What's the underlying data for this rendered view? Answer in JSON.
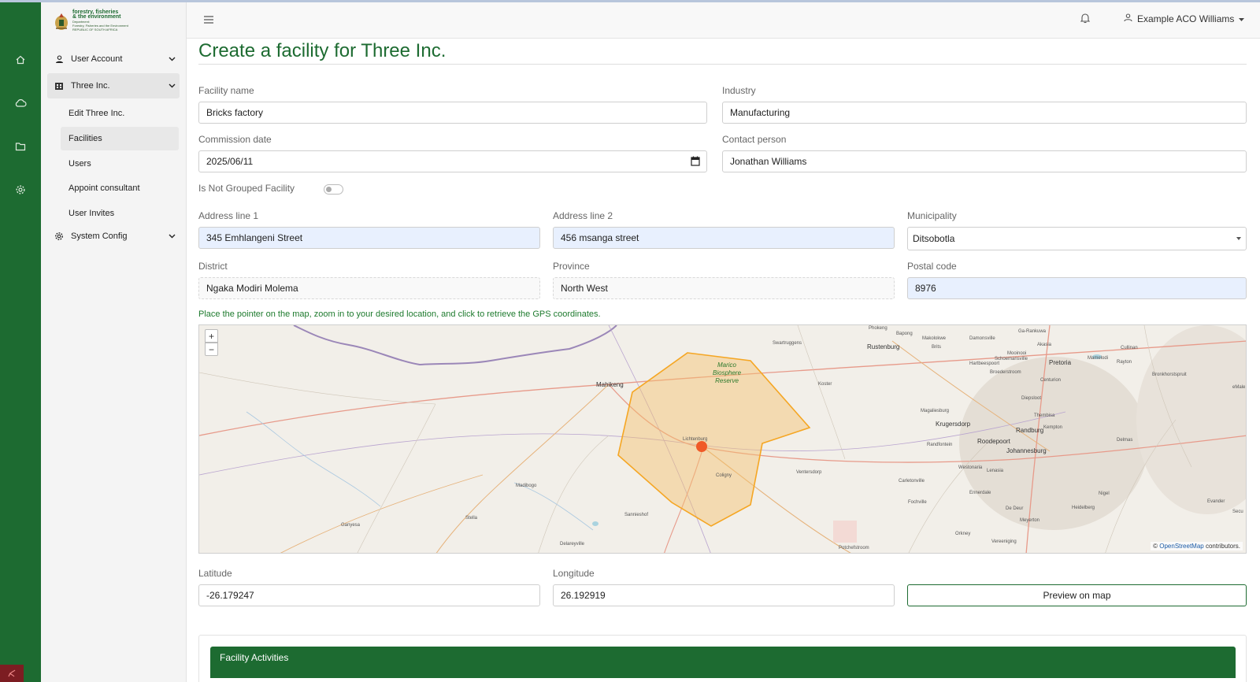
{
  "colors": {
    "brand_green": "#1d6b31",
    "autofill_bg": "#e8f0fe",
    "map_polygon": "#f5a623",
    "marker": "#f05a28"
  },
  "logo": {
    "line1": "forestry, fisheries",
    "line2": "& the environment",
    "line3": "Department:",
    "line4": "Forestry, Fisheries and the Environment",
    "line5": "REPUBLIC OF SOUTH AFRICA"
  },
  "rail": {
    "icons": [
      "home-icon",
      "cloud-icon",
      "folder-icon",
      "gear-icon"
    ]
  },
  "sidebar": {
    "groups": [
      {
        "label": "User Account",
        "icon": "user-icon"
      },
      {
        "label": "Three Inc.",
        "icon": "building-icon"
      },
      {
        "label": "System Config",
        "icon": "gear-icon"
      }
    ],
    "sub_items": [
      {
        "label": "Edit Three Inc."
      },
      {
        "label": "Facilities"
      },
      {
        "label": "Users"
      },
      {
        "label": "Appoint consultant"
      },
      {
        "label": "User Invites"
      }
    ]
  },
  "header": {
    "user_name": "Example ACO Williams"
  },
  "page": {
    "title": "Create a facility for Three Inc."
  },
  "form": {
    "facility_name": {
      "label": "Facility name",
      "value": "Bricks factory"
    },
    "industry": {
      "label": "Industry",
      "value": "Manufacturing"
    },
    "commission_date": {
      "label": "Commission date",
      "value": "2025/06/11"
    },
    "contact_person": {
      "label": "Contact person",
      "value": "Jonathan Williams"
    },
    "not_grouped": {
      "label": "Is Not Grouped Facility",
      "checked": false
    },
    "address1": {
      "label": "Address line 1",
      "value": "345 Emhlangeni Street"
    },
    "address2": {
      "label": "Address line 2",
      "value": "456 msanga street"
    },
    "municipality": {
      "label": "Municipality",
      "value": "Ditsobotla"
    },
    "district": {
      "label": "District",
      "value": "Ngaka Modiri Molema"
    },
    "province": {
      "label": "Province",
      "value": "North West"
    },
    "postal_code": {
      "label": "Postal code",
      "value": "8976"
    },
    "latitude": {
      "label": "Latitude",
      "value": "-26.179247"
    },
    "longitude": {
      "label": "Longitude",
      "value": "26.192919"
    }
  },
  "map": {
    "hint": "Place the pointer on the map, zoom in to your desired location, and click to retrieve the GPS coordinates.",
    "zoom_in": "+",
    "zoom_out": "−",
    "attribution_prefix": "©",
    "attribution_link": "OpenStreetMap",
    "attribution_suffix": "contributors.",
    "reserve_label": [
      "Marico",
      "Biosphere",
      "Reserve"
    ],
    "places": [
      "Mahikeng",
      "Lichtenburg",
      "Coligny",
      "Sannieshof",
      "Delareyville",
      "Stella",
      "Ganyesa",
      "Madibogo",
      "Swartruggens",
      "Koster",
      "Rustenburg",
      "Pretoria",
      "Magaliesburg",
      "Krugersdorp",
      "Randburg",
      "Roodepoort",
      "Johannesburg",
      "Randfontein",
      "Carletonville",
      "Ventersdorp",
      "Potchefstroom",
      "Vereeniging",
      "Meyerton",
      "De Deur",
      "Heidelberg",
      "Nigel",
      "Evander",
      "Delmas",
      "Kempton",
      "Thembisa",
      "Centurion",
      "Brits",
      "Hartbeespoort",
      "Mamelodi",
      "Cullinan",
      "Rayton",
      "Bronkhorstspruit",
      "Schoemansville",
      "Broederstroom",
      "Mooinooi",
      "Makolokwe",
      "Damonsville",
      "Ga-Rankuwa",
      "Akasia",
      "Diepsloot",
      "Fochville",
      "Westonaria",
      "Lenasia",
      "Ennerdale",
      "Orkney",
      "Phokeng",
      "Bapong",
      "Secu",
      "eMale"
    ]
  },
  "actions": {
    "preview_label": "Preview on map"
  },
  "section": {
    "activities_title": "Facility Activities"
  }
}
